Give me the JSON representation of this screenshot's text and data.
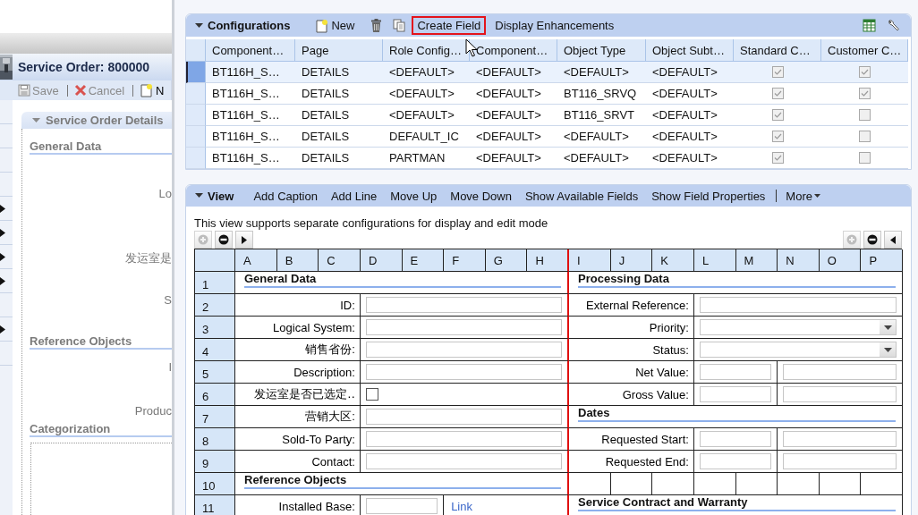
{
  "background_window": {
    "title": "Service Order: 800000",
    "toolbar": [
      {
        "kind": "save",
        "label": "Save"
      },
      {
        "kind": "cancel",
        "label": "Cancel"
      },
      {
        "kind": "new",
        "label": "N"
      }
    ],
    "section_title": "Service Order Details",
    "groups": [
      {
        "title": "General Data",
        "labels": [
          "Lo",
          "发运室是",
          "S"
        ]
      },
      {
        "title": "Reference Objects",
        "labels": [
          "I",
          "Produc"
        ]
      },
      {
        "title": "Categorization"
      }
    ]
  },
  "configurations": {
    "title": "Configurations",
    "toolbar": [
      {
        "kind": "new",
        "label": "New"
      },
      {
        "kind": "delete"
      },
      {
        "kind": "copy"
      },
      {
        "kind": "text",
        "label": "Create Field",
        "highlighted": true
      },
      {
        "kind": "text",
        "label": "Display Enhancements",
        "highlighted": false
      }
    ],
    "tools": [
      {
        "kind": "export"
      },
      {
        "kind": "settings"
      }
    ],
    "columns": [
      "Component…",
      "Page",
      "Role Config…",
      "Component…",
      "Object Type",
      "Object Subt…",
      "Standard C…",
      "Customer C…"
    ],
    "rows": [
      {
        "selected": true,
        "cells": [
          "BT116H_S…",
          "DETAILS",
          "<DEFAULT>",
          "<DEFAULT>",
          "<DEFAULT>",
          "<DEFAULT>"
        ],
        "standard": true,
        "customer": true
      },
      {
        "selected": false,
        "cells": [
          "BT116H_S…",
          "DETAILS",
          "<DEFAULT>",
          "<DEFAULT>",
          "BT116_SRVQ",
          "<DEFAULT>"
        ],
        "standard": true,
        "customer": true
      },
      {
        "selected": false,
        "cells": [
          "BT116H_S…",
          "DETAILS",
          "<DEFAULT>",
          "<DEFAULT>",
          "BT116_SRVT",
          "<DEFAULT>"
        ],
        "standard": true,
        "customer": false
      },
      {
        "selected": false,
        "cells": [
          "BT116H_S…",
          "DETAILS",
          "DEFAULT_IC",
          "<DEFAULT>",
          "<DEFAULT>",
          "<DEFAULT>"
        ],
        "standard": true,
        "customer": false
      },
      {
        "selected": false,
        "cells": [
          "BT116H_S…",
          "DETAILS",
          "PARTMAN",
          "<DEFAULT>",
          "<DEFAULT>",
          "<DEFAULT>"
        ],
        "standard": true,
        "customer": false
      }
    ]
  },
  "view": {
    "title": "View",
    "toolbar": [
      "Add Caption",
      "Add Line",
      "Move Up",
      "Move Down",
      "Show Available Fields",
      "Show Field Properties"
    ],
    "more": "More",
    "note": "This view supports separate configurations for display and edit mode",
    "left_controls": [
      {
        "kind": "add",
        "disabled": true
      },
      {
        "kind": "remove",
        "disabled": false
      },
      {
        "kind": "arrow_right",
        "disabled": false
      }
    ],
    "right_controls": [
      {
        "kind": "add",
        "disabled": true
      },
      {
        "kind": "remove",
        "disabled": false
      },
      {
        "kind": "arrow_left",
        "disabled": false
      }
    ],
    "columns": [
      "A",
      "B",
      "C",
      "D",
      "E",
      "F",
      "G",
      "H",
      "I",
      "J",
      "K",
      "L",
      "M",
      "N",
      "O",
      "P"
    ],
    "rows": [
      {
        "number": "1",
        "left": [
          {
            "kind": "caption",
            "text": "General Data"
          }
        ],
        "right": [
          {
            "kind": "caption",
            "text": "Processing Data"
          }
        ]
      },
      {
        "number": "2",
        "left": [
          {
            "kind": "label",
            "text": "ID:"
          },
          {
            "kind": "input"
          }
        ],
        "right": [
          {
            "kind": "label",
            "text": "External Reference:"
          },
          {
            "kind": "input"
          }
        ]
      },
      {
        "number": "3",
        "left": [
          {
            "kind": "label",
            "text": "Logical System:"
          },
          {
            "kind": "input"
          }
        ],
        "right": [
          {
            "kind": "label",
            "text": "Priority:"
          },
          {
            "kind": "dropdown"
          }
        ]
      },
      {
        "number": "4",
        "left": [
          {
            "kind": "label",
            "text": "销售省份:"
          },
          {
            "kind": "input"
          }
        ],
        "right": [
          {
            "kind": "label",
            "text": "Status:"
          },
          {
            "kind": "dropdown"
          }
        ]
      },
      {
        "number": "5",
        "left": [
          {
            "kind": "label",
            "text": "Description:"
          },
          {
            "kind": "input"
          }
        ],
        "right": [
          {
            "kind": "label",
            "text": "Net Value:"
          },
          {
            "kind": "input"
          },
          {
            "kind": "input"
          }
        ]
      },
      {
        "number": "6",
        "left": [
          {
            "kind": "label",
            "text": "发运室是否已选定‥"
          },
          {
            "kind": "checkbox",
            "checked": false
          }
        ],
        "right": [
          {
            "kind": "label",
            "text": "Gross Value:"
          },
          {
            "kind": "input"
          },
          {
            "kind": "input"
          }
        ]
      },
      {
        "number": "7",
        "left": [
          {
            "kind": "label",
            "text": "营销大区:"
          },
          {
            "kind": "input"
          }
        ],
        "right": [
          {
            "kind": "caption",
            "text": "Dates"
          }
        ]
      },
      {
        "number": "8",
        "left": [
          {
            "kind": "label",
            "text": "Sold-To Party:"
          },
          {
            "kind": "input"
          }
        ],
        "right": [
          {
            "kind": "label",
            "text": "Requested Start:"
          },
          {
            "kind": "input"
          },
          {
            "kind": "input"
          }
        ]
      },
      {
        "number": "9",
        "left": [
          {
            "kind": "label",
            "text": "Contact:"
          },
          {
            "kind": "input"
          }
        ],
        "right": [
          {
            "kind": "label",
            "text": "Requested End:"
          },
          {
            "kind": "input"
          },
          {
            "kind": "input"
          }
        ]
      },
      {
        "number": "10",
        "left": [
          {
            "kind": "caption",
            "text": "Reference Objects"
          }
        ],
        "right": [
          {
            "kind": "empty"
          },
          {
            "kind": "empty"
          },
          {
            "kind": "empty"
          },
          {
            "kind": "empty"
          },
          {
            "kind": "empty"
          },
          {
            "kind": "empty"
          },
          {
            "kind": "empty"
          },
          {
            "kind": "empty"
          }
        ]
      },
      {
        "number": "11",
        "left": [
          {
            "kind": "label",
            "text": "Installed Base:"
          },
          {
            "kind": "input"
          },
          {
            "kind": "link",
            "text": "Link"
          }
        ],
        "right": [
          {
            "kind": "caption",
            "text": "Service Contract and Warranty"
          }
        ]
      }
    ]
  }
}
